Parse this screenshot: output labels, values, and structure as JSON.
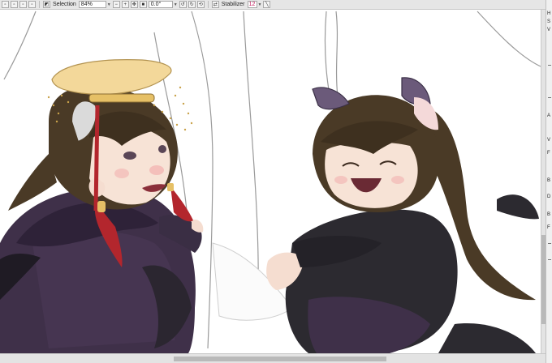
{
  "toolbar": {
    "selection_label": "Selection",
    "zoom_value": "84%",
    "zoom_out": "−",
    "zoom_in": "+",
    "angle_value": "0.0°",
    "stabilizer_label": "Stabilizer",
    "stabilizer_value": "12"
  },
  "side_panel": {
    "letters": [
      "H",
      "S",
      "V",
      "A",
      "V",
      "F",
      "B",
      "D",
      "B",
      "F"
    ]
  },
  "colors": {
    "stabilizer_accent": "#c2185b",
    "robe_purple": "#3f3049",
    "robe_black": "#2c2a30",
    "hair_brown": "#4a3a26",
    "tassel_red": "#b3262d",
    "hat_gold": "#f3d89a"
  }
}
